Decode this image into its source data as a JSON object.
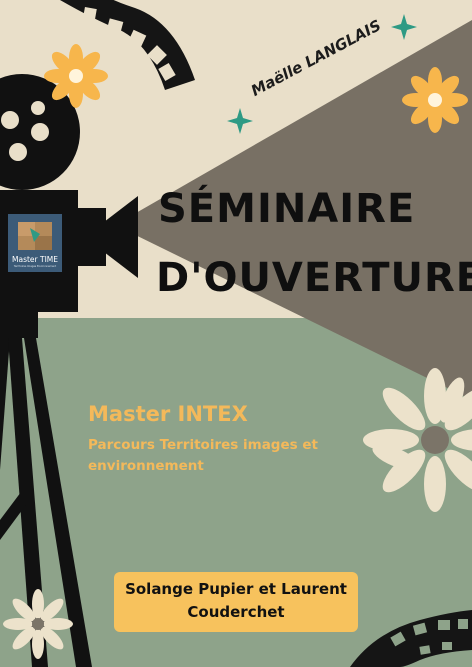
{
  "author": "Maëlle LANGLAIS",
  "title": {
    "line1": "SÉMINAIRE",
    "line2": "D'OUVERTURE"
  },
  "program": {
    "name": "Master INTEX",
    "parcours": "Parcours Territoires images et environnement"
  },
  "speakers": {
    "line1": "Solange Pupier et Laurent",
    "line2": "Couderchet"
  },
  "logo": {
    "title": "Master TIME",
    "subtitle": "Territoires Images Environnement"
  },
  "colors": {
    "cream": "#e9dfc9",
    "beam": "#787064",
    "sage": "#8ea38a",
    "accent": "#f4b95a",
    "teal": "#2e9a84",
    "flower": "#f7b64c"
  },
  "icons": [
    "film-strip-icon",
    "movie-camera-icon",
    "daisy-flower-icon",
    "sparkle-star-icon"
  ]
}
